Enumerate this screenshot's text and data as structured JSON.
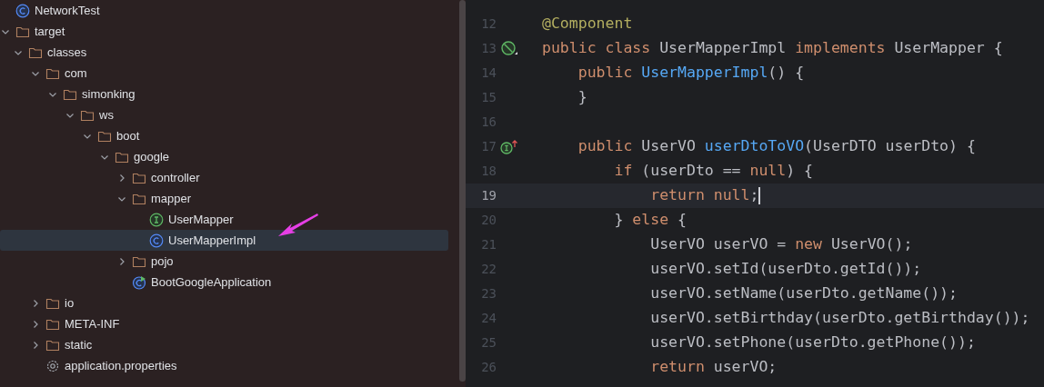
{
  "project_tree": [
    {
      "label": "NetworkTest",
      "kind": "class",
      "selected": false
    },
    {
      "label": "target",
      "kind": "folder",
      "expanded": true,
      "selected": false,
      "children": [
        {
          "label": "classes",
          "kind": "folder",
          "expanded": true,
          "selected": false,
          "children": [
            {
              "label": "com",
              "kind": "folder",
              "expanded": true,
              "selected": false,
              "children": [
                {
                  "label": "simonking",
                  "kind": "folder",
                  "expanded": true,
                  "selected": false,
                  "children": [
                    {
                      "label": "ws",
                      "kind": "folder",
                      "expanded": true,
                      "selected": false,
                      "children": [
                        {
                          "label": "boot",
                          "kind": "folder",
                          "expanded": true,
                          "selected": false,
                          "children": [
                            {
                              "label": "google",
                              "kind": "folder",
                              "expanded": true,
                              "selected": false,
                              "children": [
                                {
                                  "label": "controller",
                                  "kind": "folder",
                                  "expanded": false,
                                  "selected": false
                                },
                                {
                                  "label": "mapper",
                                  "kind": "folder",
                                  "expanded": true,
                                  "selected": false,
                                  "children": [
                                    {
                                      "label": "UserMapper",
                                      "kind": "interface",
                                      "selected": false
                                    },
                                    {
                                      "label": "UserMapperImpl",
                                      "kind": "class",
                                      "selected": true
                                    }
                                  ]
                                },
                                {
                                  "label": "pojo",
                                  "kind": "folder",
                                  "expanded": false,
                                  "selected": false
                                },
                                {
                                  "label": "BootGoogleApplication",
                                  "kind": "app",
                                  "selected": false
                                }
                              ]
                            }
                          ]
                        }
                      ]
                    }
                  ]
                }
              ]
            },
            {
              "label": "io",
              "kind": "folder",
              "expanded": false,
              "selected": false
            },
            {
              "label": "META-INF",
              "kind": "folder",
              "expanded": false,
              "selected": false
            },
            {
              "label": "static",
              "kind": "folder",
              "expanded": false,
              "selected": false
            },
            {
              "label": "application.properties",
              "kind": "properties",
              "selected": false
            }
          ]
        }
      ]
    }
  ],
  "editor": {
    "lines": [
      {
        "number": "12",
        "current": false,
        "tokens": [
          {
            "text": "@Component",
            "kind": "annotation"
          }
        ]
      },
      {
        "number": "13",
        "current": false,
        "gutter": {
          "kind": "bean"
        },
        "tokens": [
          {
            "text": "public class ",
            "kind": "keyword"
          },
          {
            "text": "UserMapperImpl ",
            "kind": "plain"
          },
          {
            "text": "implements ",
            "kind": "keyword"
          },
          {
            "text": "UserMapper {",
            "kind": "plain"
          }
        ]
      },
      {
        "number": "14",
        "current": false,
        "tokens": [
          {
            "text": "    public ",
            "kind": "keyword"
          },
          {
            "text": "UserMapperImpl",
            "kind": "method"
          },
          {
            "text": "() {",
            "kind": "plain"
          }
        ]
      },
      {
        "number": "15",
        "current": false,
        "tokens": [
          {
            "text": "    }",
            "kind": "plain"
          }
        ]
      },
      {
        "number": "16",
        "current": false
      },
      {
        "number": "17",
        "current": false,
        "gutter": {
          "kind": "implements"
        },
        "tokens": [
          {
            "text": "    public ",
            "kind": "keyword"
          },
          {
            "text": "UserVO ",
            "kind": "plain"
          },
          {
            "text": "userDtoToVO",
            "kind": "method"
          },
          {
            "text": "(UserDTO userDto) {",
            "kind": "plain"
          }
        ]
      },
      {
        "number": "18",
        "current": false,
        "tokens": [
          {
            "text": "        if ",
            "kind": "keyword"
          },
          {
            "text": "(userDto == ",
            "kind": "plain"
          },
          {
            "text": "null",
            "kind": "keyword"
          },
          {
            "text": ") {",
            "kind": "plain"
          }
        ]
      },
      {
        "number": "19",
        "current": true,
        "tokens": [
          {
            "text": "            return null",
            "kind": "keyword"
          },
          {
            "text": ";",
            "kind": "plain"
          }
        ]
      },
      {
        "number": "20",
        "current": false,
        "tokens": [
          {
            "text": "        } ",
            "kind": "plain"
          },
          {
            "text": "else ",
            "kind": "keyword"
          },
          {
            "text": "{",
            "kind": "plain"
          }
        ]
      },
      {
        "number": "21",
        "current": false,
        "tokens": [
          {
            "text": "            UserVO userVO = ",
            "kind": "plain"
          },
          {
            "text": "new ",
            "kind": "keyword"
          },
          {
            "text": "UserVO();",
            "kind": "plain"
          }
        ]
      },
      {
        "number": "22",
        "current": false,
        "tokens": [
          {
            "text": "            userVO.setId(userDto.getId());",
            "kind": "plain"
          }
        ]
      },
      {
        "number": "23",
        "current": false,
        "tokens": [
          {
            "text": "            userVO.setName(userDto.getName());",
            "kind": "plain"
          }
        ]
      },
      {
        "number": "24",
        "current": false,
        "tokens": [
          {
            "text": "            userVO.setBirthday(userDto.getBirthday());",
            "kind": "plain"
          }
        ]
      },
      {
        "number": "25",
        "current": false,
        "tokens": [
          {
            "text": "            userVO.setPhone(userDto.getPhone());",
            "kind": "plain"
          }
        ]
      },
      {
        "number": "26",
        "current": false,
        "tokens": [
          {
            "text": "            return ",
            "kind": "keyword"
          },
          {
            "text": "userVO;",
            "kind": "plain"
          }
        ]
      }
    ]
  }
}
